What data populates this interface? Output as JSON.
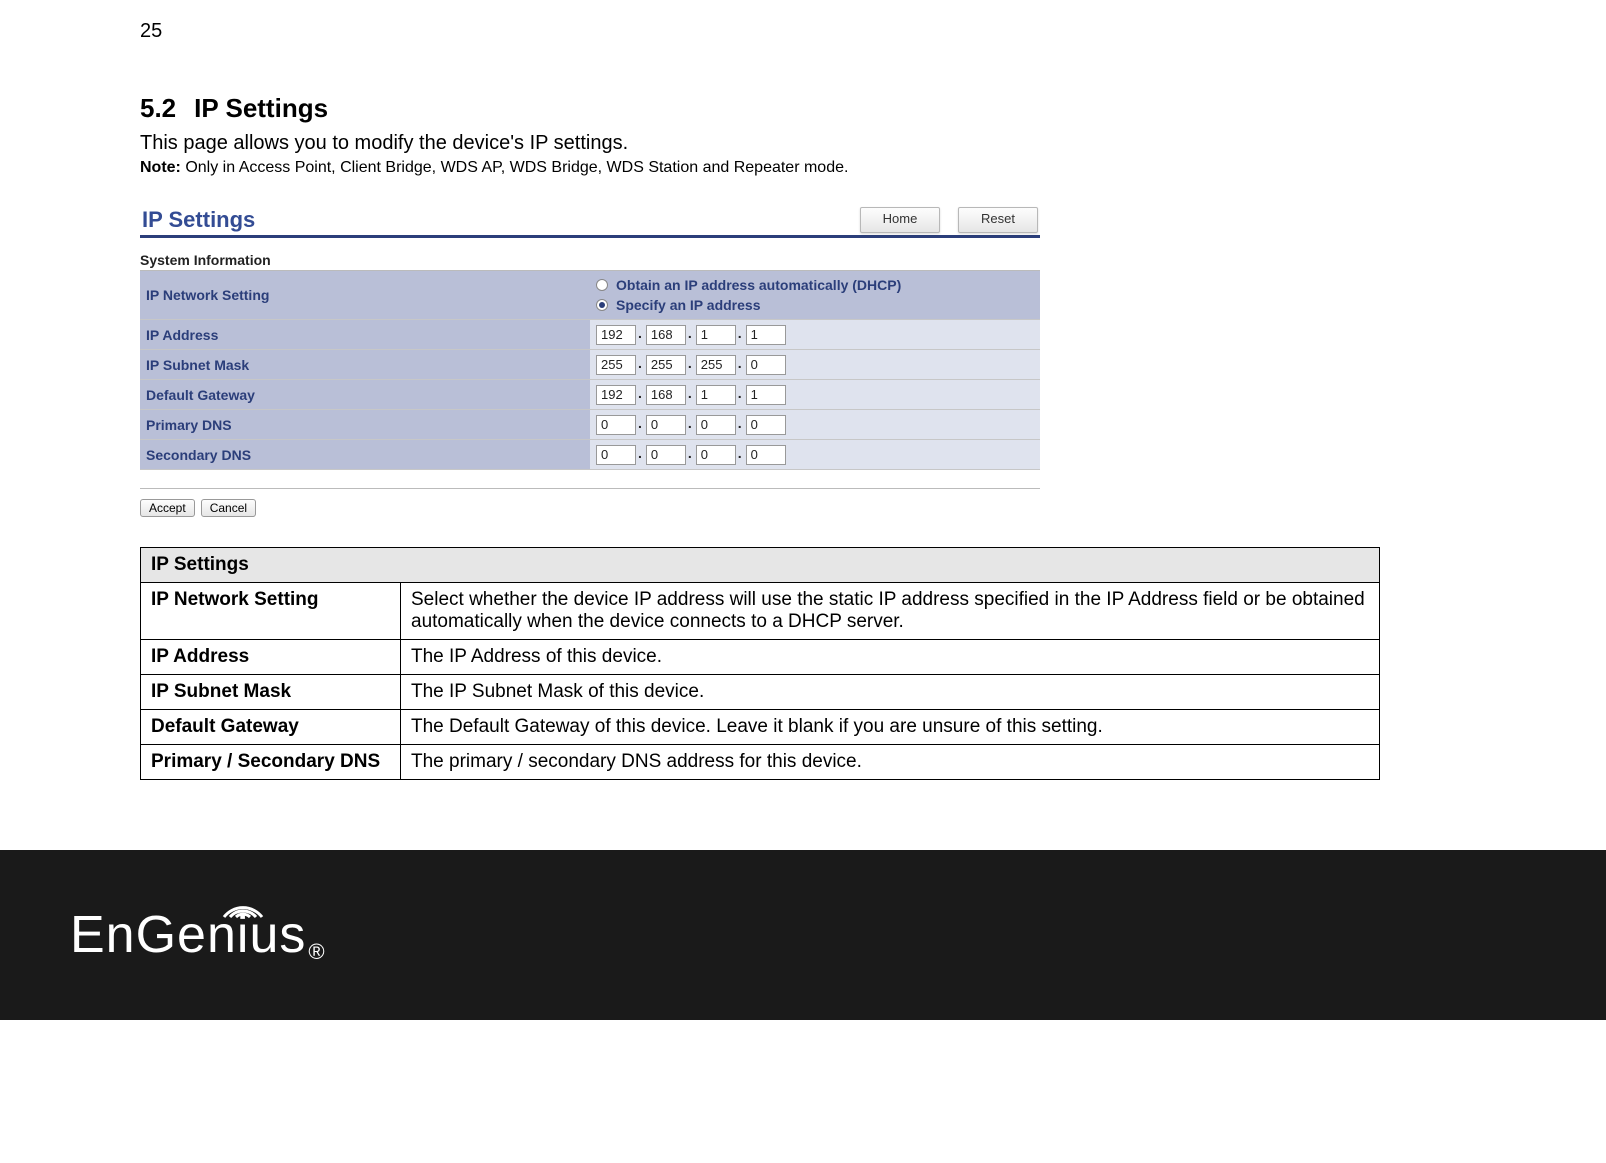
{
  "page_number": "25",
  "heading": {
    "num": "5.2",
    "title": "IP Settings"
  },
  "intro": "This page allows you to modify the device's IP settings.",
  "note": {
    "label": "Note:",
    "text": " Only in Access Point, Client Bridge, WDS AP, WDS Bridge, WDS Station and Repeater mode."
  },
  "ui": {
    "title": "IP Settings",
    "buttons": {
      "home": "Home",
      "reset": "Reset",
      "accept": "Accept",
      "cancel": "Cancel"
    },
    "sys_info": "System Information",
    "rows": {
      "net_setting": {
        "label": "IP Network Setting",
        "dhcp": "Obtain an IP address automatically (DHCP)",
        "static": "Specify an IP address",
        "selected": "static"
      },
      "ip_address": {
        "label": "IP Address",
        "oct": [
          "192",
          "168",
          "1",
          "1"
        ]
      },
      "subnet_mask": {
        "label": "IP Subnet Mask",
        "oct": [
          "255",
          "255",
          "255",
          "0"
        ]
      },
      "gateway": {
        "label": "Default Gateway",
        "oct": [
          "192",
          "168",
          "1",
          "1"
        ]
      },
      "primary_dns": {
        "label": "Primary DNS",
        "oct": [
          "0",
          "0",
          "0",
          "0"
        ]
      },
      "secondary_dns": {
        "label": "Secondary DNS",
        "oct": [
          "0",
          "0",
          "0",
          "0"
        ]
      }
    }
  },
  "desc": {
    "header": "IP Settings",
    "rows": [
      {
        "k": "IP Network Setting",
        "v": "Select whether the device IP address will use the static IP address specified in the IP Address field or be obtained automatically when the device connects to a DHCP server."
      },
      {
        "k": "IP Address",
        "v": "The IP Address of this device."
      },
      {
        "k": "IP Subnet Mask",
        "v": "The IP Subnet Mask of this device."
      },
      {
        "k": "Default Gateway",
        "v": "The Default Gateway of this device. Leave it blank if you are unsure of this setting."
      },
      {
        "k": "Primary / Secondary DNS",
        "v": "The primary / secondary DNS address for this device."
      }
    ]
  },
  "footer": {
    "brand": "EnGenius",
    "reg": "®"
  }
}
